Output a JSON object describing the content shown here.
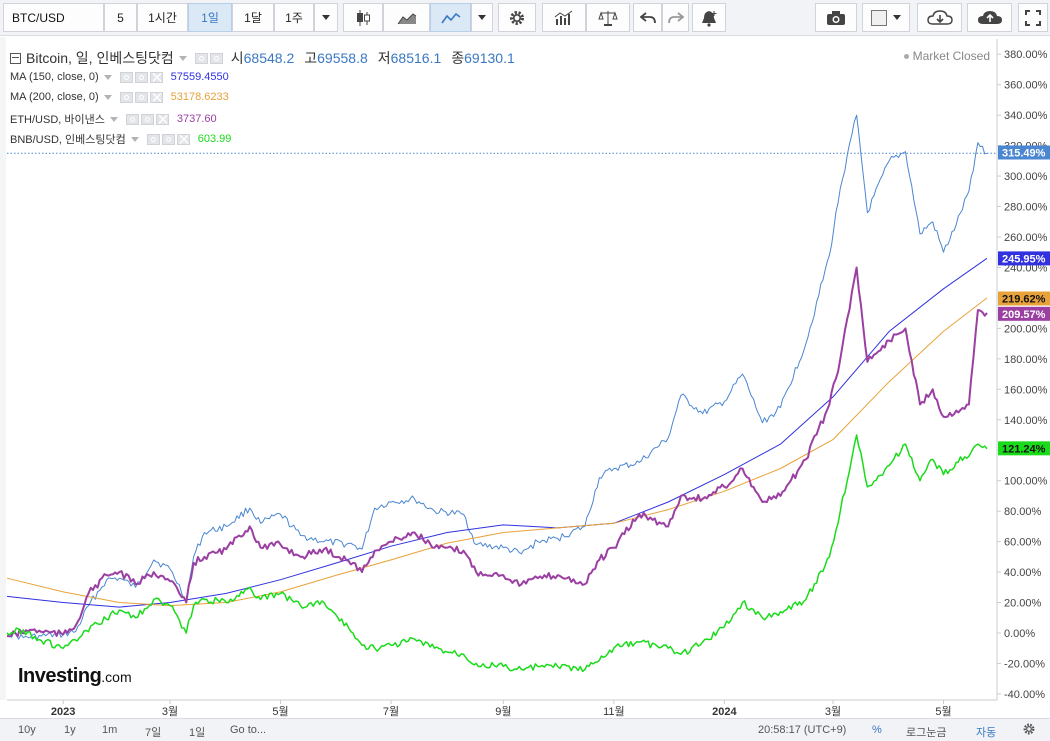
{
  "toolbar": {
    "symbol": "BTC/USD",
    "intervals": [
      "5",
      "1시간",
      "1일",
      "1달",
      "1주"
    ],
    "active_interval": "1일"
  },
  "legend": {
    "title": "Bitcoin, 일, 인베스팅닷컴",
    "o_label": "시",
    "o_value": "68548.2",
    "h_label": "고",
    "h_value": "69558.8",
    "l_label": "저",
    "l_value": "68516.1",
    "c_label": "종",
    "c_value": "69130.1",
    "market_status": "Market Closed",
    "studies": [
      {
        "label": "MA (150, close, 0)",
        "value": "57559.4550",
        "color": "#3131e0"
      },
      {
        "label": "MA (200, close, 0)",
        "value": "53178.6233",
        "color": "#e8a23a"
      },
      {
        "label": "ETH/USD, 바이낸스",
        "value": "3737.60",
        "color": "#9b3fa3"
      },
      {
        "label": "BNB/USD, 인베스팅닷컴",
        "value": "603.99",
        "color": "#1adb1a"
      }
    ]
  },
  "chart_data": {
    "type": "line",
    "title": "Bitcoin, 일, 인베스팅닷컴",
    "ylabel_unit": "%",
    "y_ticks": [
      "380.00%",
      "360.00%",
      "340.00%",
      "320.00%",
      "300.00%",
      "280.00%",
      "260.00%",
      "240.00%",
      "220.00%",
      "200.00%",
      "180.00%",
      "160.00%",
      "140.00%",
      "120.00%",
      "100.00%",
      "80.00%",
      "60.00%",
      "40.00%",
      "20.00%",
      "0.00%",
      "-20.00%",
      "-40.00%"
    ],
    "ylim": [
      -44,
      390
    ],
    "xlim": [
      "2022-12-01",
      "2024-05-25"
    ],
    "x_ticks": [
      {
        "label": "2023",
        "date": "2023-01-01",
        "bold": true
      },
      {
        "label": "3월",
        "date": "2023-03-01"
      },
      {
        "label": "5월",
        "date": "2023-05-01"
      },
      {
        "label": "7월",
        "date": "2023-07-01"
      },
      {
        "label": "9월",
        "date": "2023-09-01"
      },
      {
        "label": "11월",
        "date": "2023-11-01"
      },
      {
        "label": "2024",
        "date": "2024-01-01",
        "bold": true
      },
      {
        "label": "3월",
        "date": "2024-03-01"
      },
      {
        "label": "5월",
        "date": "2024-05-01"
      }
    ],
    "series": [
      {
        "name": "Bitcoin",
        "color": "#4a86d1",
        "width": 1,
        "badge": "315.49%",
        "points": [
          [
            "2022-12-01",
            0
          ],
          [
            "2022-12-10",
            -3
          ],
          [
            "2022-12-20",
            -2
          ],
          [
            "2023-01-01",
            -1
          ],
          [
            "2023-01-08",
            1
          ],
          [
            "2023-01-15",
            18
          ],
          [
            "2023-01-25",
            35
          ],
          [
            "2023-02-01",
            36
          ],
          [
            "2023-02-10",
            30
          ],
          [
            "2023-02-20",
            48
          ],
          [
            "2023-03-01",
            42
          ],
          [
            "2023-03-10",
            22
          ],
          [
            "2023-03-14",
            50
          ],
          [
            "2023-03-20",
            66
          ],
          [
            "2023-04-01",
            70
          ],
          [
            "2023-04-14",
            82
          ],
          [
            "2023-04-20",
            72
          ],
          [
            "2023-05-01",
            78
          ],
          [
            "2023-05-12",
            64
          ],
          [
            "2023-05-25",
            60
          ],
          [
            "2023-06-10",
            58
          ],
          [
            "2023-06-15",
            55
          ],
          [
            "2023-06-22",
            82
          ],
          [
            "2023-07-01",
            86
          ],
          [
            "2023-07-14",
            88
          ],
          [
            "2023-07-25",
            80
          ],
          [
            "2023-08-10",
            78
          ],
          [
            "2023-08-17",
            58
          ],
          [
            "2023-09-01",
            56
          ],
          [
            "2023-09-11",
            52
          ],
          [
            "2023-09-20",
            60
          ],
          [
            "2023-10-01",
            62
          ],
          [
            "2023-10-16",
            70
          ],
          [
            "2023-10-24",
            102
          ],
          [
            "2023-11-01",
            108
          ],
          [
            "2023-11-15",
            112
          ],
          [
            "2023-12-01",
            128
          ],
          [
            "2023-12-08",
            156
          ],
          [
            "2023-12-20",
            144
          ],
          [
            "2024-01-01",
            152
          ],
          [
            "2024-01-11",
            170
          ],
          [
            "2024-01-22",
            138
          ],
          [
            "2024-02-01",
            148
          ],
          [
            "2024-02-15",
            190
          ],
          [
            "2024-02-28",
            248
          ],
          [
            "2024-03-05",
            292
          ],
          [
            "2024-03-14",
            340
          ],
          [
            "2024-03-20",
            276
          ],
          [
            "2024-04-01",
            310
          ],
          [
            "2024-04-10",
            316
          ],
          [
            "2024-04-18",
            262
          ],
          [
            "2024-04-25",
            270
          ],
          [
            "2024-05-01",
            250
          ],
          [
            "2024-05-08",
            268
          ],
          [
            "2024-05-15",
            290
          ],
          [
            "2024-05-20",
            322
          ],
          [
            "2024-05-25",
            315
          ]
        ]
      },
      {
        "name": "MA (150, close, 0)",
        "color": "#3131e0",
        "width": 1,
        "badge": "245.95%",
        "points": [
          [
            "2022-12-01",
            24
          ],
          [
            "2023-01-01",
            20
          ],
          [
            "2023-02-01",
            17
          ],
          [
            "2023-03-01",
            20
          ],
          [
            "2023-04-01",
            26
          ],
          [
            "2023-05-01",
            35
          ],
          [
            "2023-06-01",
            46
          ],
          [
            "2023-07-01",
            57
          ],
          [
            "2023-08-01",
            66
          ],
          [
            "2023-09-01",
            71
          ],
          [
            "2023-10-01",
            69
          ],
          [
            "2023-11-01",
            72
          ],
          [
            "2023-12-01",
            86
          ],
          [
            "2024-01-01",
            104
          ],
          [
            "2024-02-01",
            124
          ],
          [
            "2024-03-01",
            155
          ],
          [
            "2024-04-01",
            198
          ],
          [
            "2024-05-01",
            226
          ],
          [
            "2024-05-25",
            246
          ]
        ]
      },
      {
        "name": "MA (200, close, 0)",
        "color": "#e8a23a",
        "width": 1,
        "badge": "219.62%",
        "points": [
          [
            "2022-12-01",
            36
          ],
          [
            "2023-01-01",
            27
          ],
          [
            "2023-02-01",
            20
          ],
          [
            "2023-03-01",
            18
          ],
          [
            "2023-04-01",
            20
          ],
          [
            "2023-05-01",
            27
          ],
          [
            "2023-06-01",
            38
          ],
          [
            "2023-07-01",
            48
          ],
          [
            "2023-08-01",
            59
          ],
          [
            "2023-09-01",
            66
          ],
          [
            "2023-10-01",
            69
          ],
          [
            "2023-11-01",
            72
          ],
          [
            "2023-12-01",
            81
          ],
          [
            "2024-01-01",
            93
          ],
          [
            "2024-02-01",
            108
          ],
          [
            "2024-03-01",
            127
          ],
          [
            "2024-04-01",
            165
          ],
          [
            "2024-05-01",
            198
          ],
          [
            "2024-05-25",
            220
          ]
        ]
      },
      {
        "name": "ETH/USD, 바이낸스",
        "color": "#9b3fa3",
        "width": 2,
        "badge": "209.57%",
        "points": [
          [
            "2022-12-01",
            -2
          ],
          [
            "2022-12-15",
            2
          ],
          [
            "2023-01-01",
            -1
          ],
          [
            "2023-01-08",
            5
          ],
          [
            "2023-01-15",
            26
          ],
          [
            "2023-01-25",
            38
          ],
          [
            "2023-02-01",
            40
          ],
          [
            "2023-02-10",
            32
          ],
          [
            "2023-02-20",
            40
          ],
          [
            "2023-03-01",
            34
          ],
          [
            "2023-03-10",
            20
          ],
          [
            "2023-03-14",
            46
          ],
          [
            "2023-03-20",
            50
          ],
          [
            "2023-04-01",
            55
          ],
          [
            "2023-04-14",
            70
          ],
          [
            "2023-04-20",
            56
          ],
          [
            "2023-05-01",
            58
          ],
          [
            "2023-05-12",
            50
          ],
          [
            "2023-05-25",
            55
          ],
          [
            "2023-06-10",
            46
          ],
          [
            "2023-06-15",
            40
          ],
          [
            "2023-06-22",
            54
          ],
          [
            "2023-07-01",
            60
          ],
          [
            "2023-07-14",
            66
          ],
          [
            "2023-07-25",
            56
          ],
          [
            "2023-08-10",
            54
          ],
          [
            "2023-08-17",
            40
          ],
          [
            "2023-09-01",
            38
          ],
          [
            "2023-09-11",
            32
          ],
          [
            "2023-09-20",
            36
          ],
          [
            "2023-10-01",
            38
          ],
          [
            "2023-10-16",
            32
          ],
          [
            "2023-10-24",
            48
          ],
          [
            "2023-11-01",
            56
          ],
          [
            "2023-11-15",
            78
          ],
          [
            "2023-12-01",
            70
          ],
          [
            "2023-12-08",
            90
          ],
          [
            "2023-12-20",
            88
          ],
          [
            "2024-01-01",
            96
          ],
          [
            "2024-01-11",
            108
          ],
          [
            "2024-01-22",
            86
          ],
          [
            "2024-02-01",
            90
          ],
          [
            "2024-02-15",
            114
          ],
          [
            "2024-02-28",
            150
          ],
          [
            "2024-03-05",
            180
          ],
          [
            "2024-03-14",
            240
          ],
          [
            "2024-03-20",
            178
          ],
          [
            "2024-04-01",
            192
          ],
          [
            "2024-04-10",
            200
          ],
          [
            "2024-04-18",
            150
          ],
          [
            "2024-04-25",
            160
          ],
          [
            "2024-05-01",
            142
          ],
          [
            "2024-05-08",
            146
          ],
          [
            "2024-05-15",
            150
          ],
          [
            "2024-05-20",
            212
          ],
          [
            "2024-05-25",
            210
          ]
        ]
      },
      {
        "name": "BNB/USD, 인베스팅닷컴",
        "color": "#1adb1a",
        "width": 1.5,
        "badge": "121.24%",
        "points": [
          [
            "2022-12-01",
            0
          ],
          [
            "2022-12-10",
            2
          ],
          [
            "2022-12-20",
            -5
          ],
          [
            "2023-01-01",
            -10
          ],
          [
            "2023-01-10",
            -3
          ],
          [
            "2023-01-20",
            6
          ],
          [
            "2023-02-01",
            15
          ],
          [
            "2023-02-10",
            10
          ],
          [
            "2023-02-20",
            22
          ],
          [
            "2023-03-01",
            18
          ],
          [
            "2023-03-10",
            0
          ],
          [
            "2023-03-14",
            18
          ],
          [
            "2023-03-20",
            22
          ],
          [
            "2023-04-01",
            20
          ],
          [
            "2023-04-14",
            30
          ],
          [
            "2023-04-20",
            22
          ],
          [
            "2023-05-01",
            26
          ],
          [
            "2023-05-12",
            18
          ],
          [
            "2023-05-25",
            20
          ],
          [
            "2023-06-10",
            0
          ],
          [
            "2023-06-15",
            -8
          ],
          [
            "2023-06-22",
            -10
          ],
          [
            "2023-07-01",
            -8
          ],
          [
            "2023-07-14",
            -4
          ],
          [
            "2023-07-25",
            -10
          ],
          [
            "2023-08-10",
            -14
          ],
          [
            "2023-08-17",
            -20
          ],
          [
            "2023-09-01",
            -22
          ],
          [
            "2023-09-11",
            -24
          ],
          [
            "2023-09-20",
            -22
          ],
          [
            "2023-10-01",
            -22
          ],
          [
            "2023-10-16",
            -24
          ],
          [
            "2023-10-24",
            -18
          ],
          [
            "2023-11-01",
            -10
          ],
          [
            "2023-11-15",
            -6
          ],
          [
            "2023-12-01",
            -10
          ],
          [
            "2023-12-08",
            -14
          ],
          [
            "2023-12-20",
            -6
          ],
          [
            "2024-01-01",
            4
          ],
          [
            "2024-01-11",
            20
          ],
          [
            "2024-01-22",
            10
          ],
          [
            "2024-02-01",
            14
          ],
          [
            "2024-02-15",
            22
          ],
          [
            "2024-02-28",
            50
          ],
          [
            "2024-03-05",
            80
          ],
          [
            "2024-03-14",
            130
          ],
          [
            "2024-03-20",
            96
          ],
          [
            "2024-04-01",
            110
          ],
          [
            "2024-04-10",
            124
          ],
          [
            "2024-04-18",
            100
          ],
          [
            "2024-04-25",
            114
          ],
          [
            "2024-05-01",
            104
          ],
          [
            "2024-05-08",
            112
          ],
          [
            "2024-05-15",
            116
          ],
          [
            "2024-05-20",
            124
          ],
          [
            "2024-05-25",
            121
          ]
        ]
      }
    ]
  },
  "brand": {
    "name": "Investing",
    "suffix": ".com"
  },
  "bottom": {
    "ranges": [
      "10y",
      "1y",
      "1m",
      "7일",
      "1일"
    ],
    "goto": "Go to...",
    "time": "20:58:17 (UTC+9)",
    "percent": "%",
    "log": "로그눈금",
    "auto": "자동"
  }
}
